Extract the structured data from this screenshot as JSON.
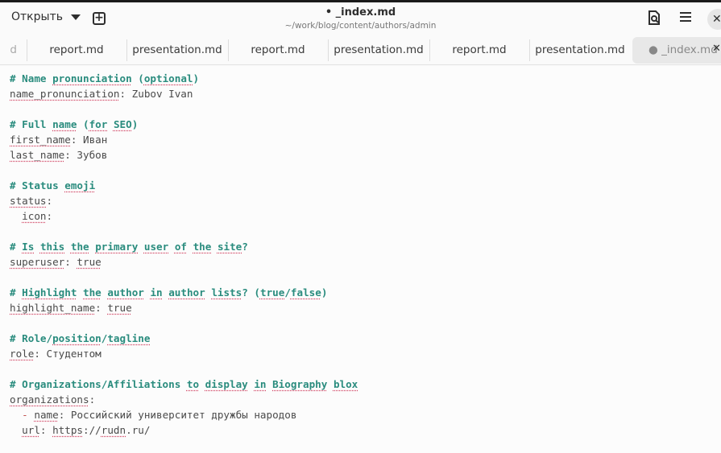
{
  "header": {
    "open_label": "Открыть",
    "title": "• _index.md",
    "subtitle": "~/work/blog/content/authors/admin"
  },
  "tabs": [
    {
      "label": "d"
    },
    {
      "label": "report.md"
    },
    {
      "label": "presentation.md"
    },
    {
      "label": "report.md"
    },
    {
      "label": "presentation.md"
    },
    {
      "label": "report.md"
    },
    {
      "label": "presentation.md"
    },
    {
      "label": "● _index.md",
      "active": true
    }
  ],
  "editor": {
    "lines": [
      [
        {
          "t": "# Name ",
          "c": "c"
        },
        {
          "t": "pronunciation",
          "c": "c u"
        },
        {
          "t": " (",
          "c": "c"
        },
        {
          "t": "optional",
          "c": "c u"
        },
        {
          "t": ")",
          "c": "c"
        }
      ],
      [
        {
          "t": "name_pronunciation",
          "c": "u"
        },
        {
          "t": ": Zubov Ivan"
        }
      ],
      [],
      [
        {
          "t": "# Full ",
          "c": "c"
        },
        {
          "t": "name",
          "c": "c u"
        },
        {
          "t": " (",
          "c": "c"
        },
        {
          "t": "for",
          "c": "c u"
        },
        {
          "t": " ",
          "c": "c"
        },
        {
          "t": "SEO",
          "c": "c u"
        },
        {
          "t": ")",
          "c": "c"
        }
      ],
      [
        {
          "t": "first_name",
          "c": "u"
        },
        {
          "t": ": Иван"
        }
      ],
      [
        {
          "t": "last_name",
          "c": "u"
        },
        {
          "t": ": Зубов"
        }
      ],
      [],
      [
        {
          "t": "# Status ",
          "c": "c"
        },
        {
          "t": "emoji",
          "c": "c u"
        }
      ],
      [
        {
          "t": "status",
          "c": "u"
        },
        {
          "t": ":"
        }
      ],
      [
        {
          "t": "  "
        },
        {
          "t": "icon",
          "c": "u"
        },
        {
          "t": ":"
        }
      ],
      [],
      [
        {
          "t": "# ",
          "c": "c"
        },
        {
          "t": "Is",
          "c": "c u"
        },
        {
          "t": " ",
          "c": "c"
        },
        {
          "t": "this",
          "c": "c u"
        },
        {
          "t": " ",
          "c": "c"
        },
        {
          "t": "the",
          "c": "c u"
        },
        {
          "t": " ",
          "c": "c"
        },
        {
          "t": "primary",
          "c": "c u"
        },
        {
          "t": " ",
          "c": "c"
        },
        {
          "t": "user",
          "c": "c u"
        },
        {
          "t": " ",
          "c": "c"
        },
        {
          "t": "of",
          "c": "c u"
        },
        {
          "t": " ",
          "c": "c"
        },
        {
          "t": "the",
          "c": "c u"
        },
        {
          "t": " ",
          "c": "c"
        },
        {
          "t": "site",
          "c": "c u"
        },
        {
          "t": "?",
          "c": "c"
        }
      ],
      [
        {
          "t": "superuser",
          "c": "u"
        },
        {
          "t": ": "
        },
        {
          "t": "true",
          "c": "u"
        }
      ],
      [],
      [
        {
          "t": "# ",
          "c": "c"
        },
        {
          "t": "Highlight",
          "c": "c u"
        },
        {
          "t": " ",
          "c": "c"
        },
        {
          "t": "the",
          "c": "c u"
        },
        {
          "t": " ",
          "c": "c"
        },
        {
          "t": "author",
          "c": "c u"
        },
        {
          "t": " ",
          "c": "c"
        },
        {
          "t": "in",
          "c": "c u"
        },
        {
          "t": " ",
          "c": "c"
        },
        {
          "t": "author",
          "c": "c u"
        },
        {
          "t": " ",
          "c": "c"
        },
        {
          "t": "lists",
          "c": "c u"
        },
        {
          "t": "? (",
          "c": "c"
        },
        {
          "t": "true",
          "c": "c u"
        },
        {
          "t": "/",
          "c": "c"
        },
        {
          "t": "false",
          "c": "c u"
        },
        {
          "t": ")",
          "c": "c"
        }
      ],
      [
        {
          "t": "highlight_name",
          "c": "u"
        },
        {
          "t": ": "
        },
        {
          "t": "true",
          "c": "u"
        }
      ],
      [],
      [
        {
          "t": "# Role/",
          "c": "c"
        },
        {
          "t": "position",
          "c": "c u"
        },
        {
          "t": "/",
          "c": "c"
        },
        {
          "t": "tagline",
          "c": "c u"
        }
      ],
      [
        {
          "t": "role",
          "c": "u"
        },
        {
          "t": ": Студентом"
        }
      ],
      [],
      [
        {
          "t": "# Organizations/Affiliations ",
          "c": "c"
        },
        {
          "t": "to",
          "c": "c u"
        },
        {
          "t": " ",
          "c": "c"
        },
        {
          "t": "display",
          "c": "c u"
        },
        {
          "t": " ",
          "c": "c"
        },
        {
          "t": "in",
          "c": "c u"
        },
        {
          "t": " ",
          "c": "c"
        },
        {
          "t": "Biography",
          "c": "c u"
        },
        {
          "t": " ",
          "c": "c"
        },
        {
          "t": "blox",
          "c": "c u"
        }
      ],
      [
        {
          "t": "organizations",
          "c": "u"
        },
        {
          "t": ":"
        }
      ],
      [
        {
          "t": "  "
        },
        {
          "t": "-",
          "c": "dash"
        },
        {
          "t": " "
        },
        {
          "t": "name",
          "c": "u"
        },
        {
          "t": ": Российский университет дружбы народов"
        }
      ],
      [
        {
          "t": "  "
        },
        {
          "t": "url",
          "c": "u"
        },
        {
          "t": ": "
        },
        {
          "t": "https",
          "c": "u"
        },
        {
          "t": "://"
        },
        {
          "t": "rudn",
          "c": "u"
        },
        {
          "t": ".ru/"
        }
      ]
    ]
  }
}
